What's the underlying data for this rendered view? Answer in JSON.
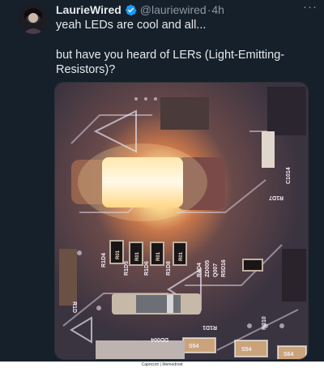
{
  "post": {
    "display_name": "LaurieWired",
    "handle": "@lauriewired",
    "separator": "·",
    "time": "4h",
    "more_label": "···",
    "text_line1": "yeah LEDs are cool and all...",
    "text_line2": "but have you heard of LERs (Light-Emitting-Resistors)?",
    "verified_icon": "verified-badge-icon",
    "accent_color": "#1d9bf0"
  },
  "media": {
    "pcb_labels": [
      "R1D4",
      "R1D5",
      "R1D6",
      "R1D8",
      "R4D4",
      "ZD005",
      "Q007",
      "R5D16",
      "R1D1",
      "R010",
      "R016",
      "C1014",
      "R1D7",
      "Q1D0D",
      "R1D",
      "R2D",
      "R1D",
      "DD004",
      "RD0",
      "S54",
      "S54",
      "S64"
    ],
    "component_markings": [
      "R01",
      "R01",
      "R01",
      "R01"
    ]
  },
  "watermark": {
    "text": "Capricorn | Memedroid"
  }
}
